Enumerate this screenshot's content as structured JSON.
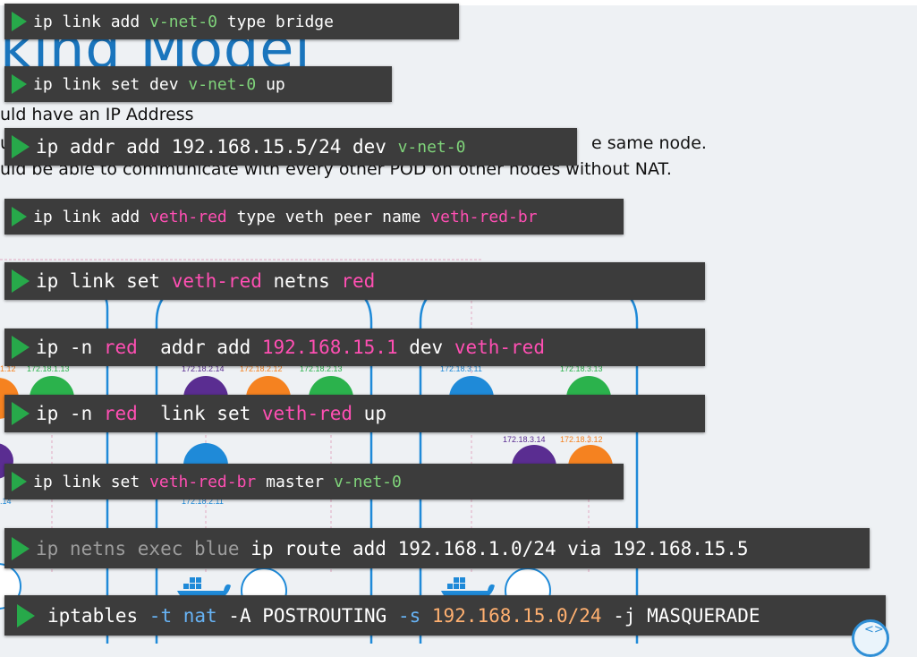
{
  "slide": {
    "title": "king Model",
    "bullets": [
      "uld have an IP Address",
      "u",
      "e same node.",
      "uld be able to communicate with every other POD on other nodes without NAT."
    ]
  },
  "diagram": {
    "node1_ips": [
      "1.12",
      "172.18.1.13"
    ],
    "node1_ip_bottom": ".14",
    "node2_ips": [
      "172.18.2.14",
      "172.18.2.12",
      "172.18.2.13"
    ],
    "node2_ip_bottom": "172.18.2.11",
    "node3_ips": [
      "172.18.3.11",
      "172.18.3.13"
    ],
    "node3_ips_bottom": [
      "172.18.3.14",
      "172.18.3.12"
    ]
  },
  "commands": {
    "c1": [
      "ip link add ",
      "v-net-0",
      " type bridge"
    ],
    "c2": [
      "ip link set dev ",
      "v-net-0",
      " up"
    ],
    "c3": [
      "ip addr add 192.168.15.5/24 dev ",
      "v-net-0"
    ],
    "c4": [
      "ip link add ",
      "veth-red",
      " type veth peer name ",
      "veth-red-br"
    ],
    "c5": [
      "ip link set ",
      "veth-red",
      " netns ",
      "red"
    ],
    "c6": [
      "ip -n ",
      "red",
      "  addr add ",
      "192.168.15.1",
      " dev ",
      "veth-red"
    ],
    "c7": [
      "ip -n ",
      "red",
      "  link set ",
      "veth-red",
      " up"
    ],
    "c8": [
      "ip link set ",
      "veth-red-br",
      " master ",
      "v-net-0"
    ],
    "c9": [
      "ip netns exec blue",
      " ip route add 192.168.1.0/24 via 192.168.15.5"
    ],
    "c10": [
      "iptables ",
      "-t nat",
      " -A POSTROUTING ",
      "-s",
      " ",
      "192.168.15.0/24",
      " -j MASQUERADE"
    ]
  },
  "icons": [
    "play-icon",
    "docker-icon",
    "logo-icon"
  ],
  "colors": {
    "command_bg": "#3c3c3c",
    "play": "#27a94a",
    "bridge_name": "#7fd37a",
    "namespace_items": "#ff4fb3",
    "node_border": "#1f8ad8",
    "pod_green": "#2bb24c",
    "pod_orange": "#f58220",
    "pod_purple": "#5a2d91",
    "pod_blue": "#1f8ad8"
  }
}
